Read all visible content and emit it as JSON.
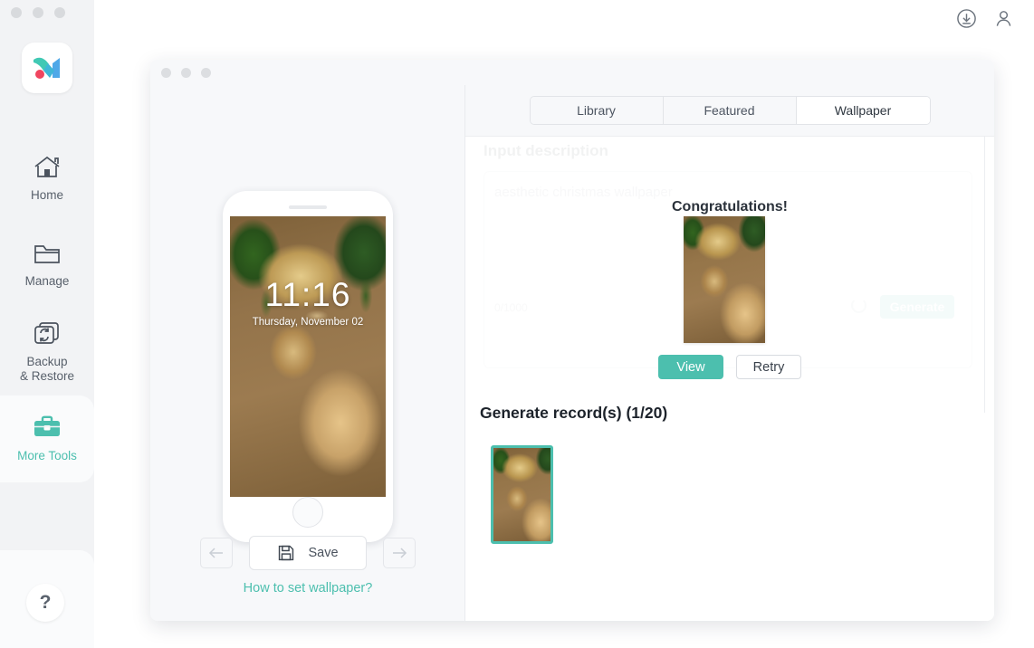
{
  "window_controls": {
    "dots": [
      "close",
      "minimize",
      "maximize"
    ]
  },
  "sidebar": {
    "logo_name": "mobitrix-logo",
    "items": [
      {
        "id": "home",
        "label": "Home",
        "icon": "home-icon",
        "active": false
      },
      {
        "id": "manage",
        "label": "Manage",
        "icon": "folder-icon",
        "active": false
      },
      {
        "id": "backup-restore",
        "label_line1": "Backup",
        "label_line2": "& Restore",
        "icon": "backup-restore-icon",
        "active": false
      },
      {
        "id": "more-tools",
        "label": "More Tools",
        "icon": "briefcase-icon",
        "active": true
      }
    ],
    "help_label": "?"
  },
  "topbar": {
    "download_icon": "download-icon",
    "account_icon": "user-account-icon"
  },
  "inner_window": {
    "tabs": [
      {
        "id": "library",
        "label": "Library",
        "active": false
      },
      {
        "id": "featured",
        "label": "Featured",
        "active": false
      },
      {
        "id": "wallpaper",
        "label": "Wallpaper",
        "active": true
      }
    ]
  },
  "preview": {
    "phone": {
      "lock_time": "11:16",
      "lock_date": "Thursday, November 02"
    },
    "prev_label": "←",
    "next_label": "→",
    "save_label": "Save",
    "save_icon": "floppy-disk-icon",
    "howto_link": "How to set wallpaper?"
  },
  "generator_form": {
    "label": "Input description",
    "placeholder": "aesthetic christmas wallpaper",
    "char_count": "0/1000",
    "generate_label": "Generate"
  },
  "modal": {
    "title": "Congratulations!",
    "thumbnail_name": "generated-wallpaper-preview",
    "view_label": "View",
    "retry_label": "Retry"
  },
  "records": {
    "title": "Generate record(s) (1/20)",
    "count_current": 1,
    "count_total": 20,
    "items": [
      {
        "id": "record-1",
        "selected": true
      }
    ]
  },
  "colors": {
    "accent_teal": "#4cbfae",
    "sidebar_bg": "#f2f3f5",
    "panel_bg": "#f7f8fa",
    "text_primary": "#2b323b",
    "text_muted": "#8d949d"
  }
}
